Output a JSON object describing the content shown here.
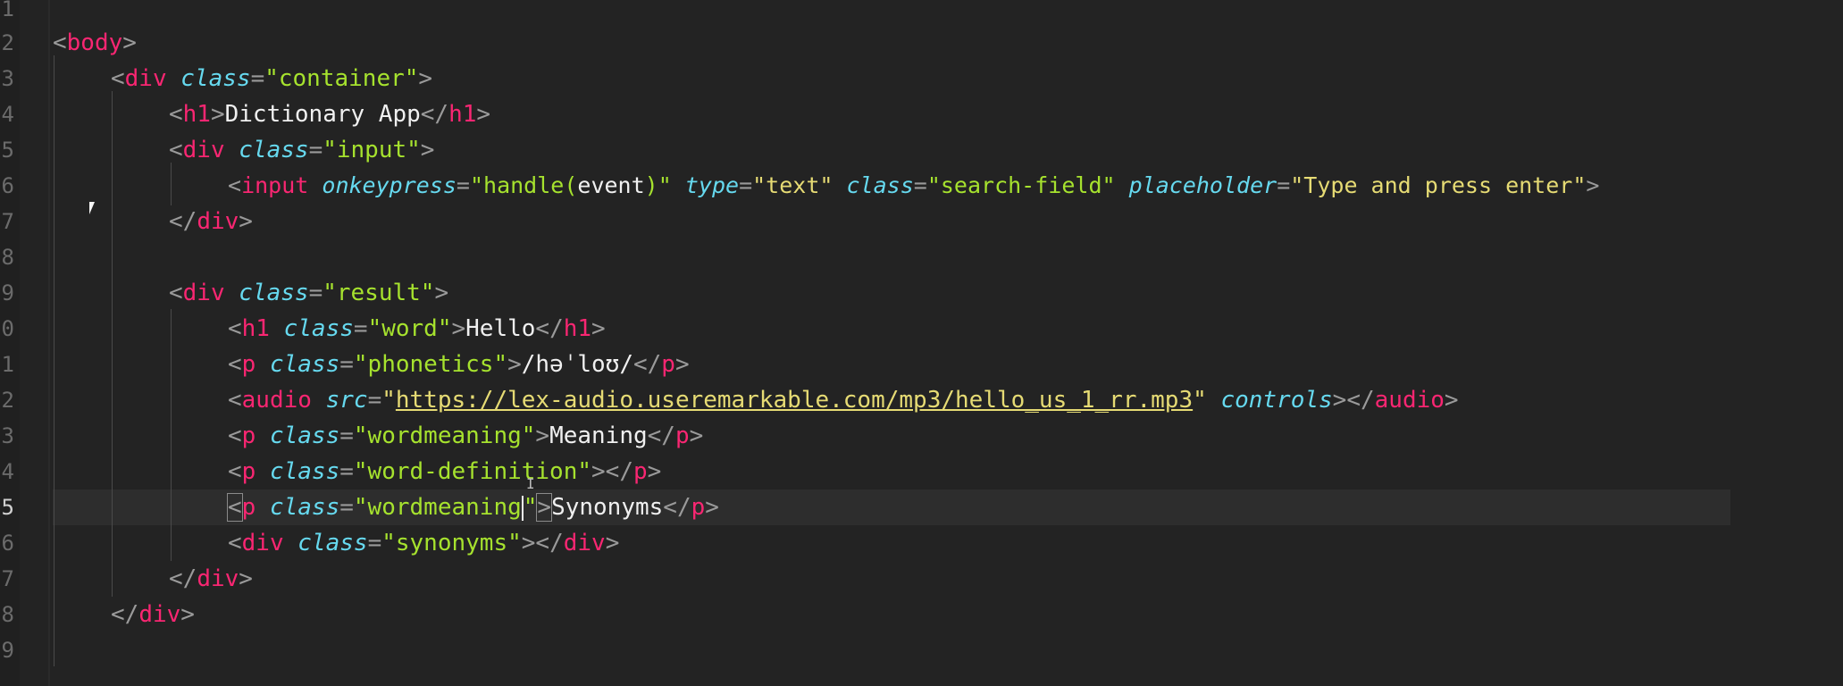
{
  "line_numbers": [
    "1",
    "2",
    "3",
    "4",
    "5",
    "6",
    "7",
    "8",
    "9",
    "0",
    "1",
    "2",
    "3",
    "4",
    "5",
    "6",
    "7",
    "8",
    "9"
  ],
  "code": {
    "l2": {
      "open": "<",
      "tag": "body",
      "close": ">"
    },
    "l3": {
      "open": "<",
      "tag": "div",
      "attr": "class",
      "eq": "=",
      "val": "\"container\"",
      "close": ">"
    },
    "l4": {
      "open": "<",
      "tag": "h1",
      "gt": ">",
      "text": "Dictionary App",
      "end_open": "</",
      "end_tag": "h1",
      "close": ">"
    },
    "l5": {
      "open": "<",
      "tag": "div",
      "attr": "class",
      "eq": "=",
      "val": "\"input\"",
      "close": ">"
    },
    "l6": {
      "open": "<",
      "tag": "input",
      "attr1": "onkeypress",
      "eq": "=",
      "q": "\"",
      "val1": "handle(",
      "val1b": "event",
      "val1c": ")",
      "attr2": "type",
      "val2": "\"text\"",
      "attr3": "class",
      "val3": "\"search-field\"",
      "attr4": "placeholder",
      "val4": "\"Type and press enter\"",
      "close": ">"
    },
    "l7": {
      "end_open": "</",
      "end_tag": "div",
      "close": ">"
    },
    "l9": {
      "open": "<",
      "tag": "div",
      "attr": "class",
      "eq": "=",
      "val": "\"result\"",
      "close": ">"
    },
    "l10": {
      "open": "<",
      "tag": "h1",
      "attr": "class",
      "eq": "=",
      "val": "\"word\"",
      "gt": ">",
      "text": "Hello",
      "end_open": "</",
      "end_tag": "h1",
      "close": ">"
    },
    "l11": {
      "open": "<",
      "tag": "p",
      "attr": "class",
      "eq": "=",
      "val": "\"phonetics\"",
      "gt": ">",
      "text": "/həˈloʊ/",
      "end_open": "</",
      "end_tag": "p",
      "close": ">"
    },
    "l12": {
      "open": "<",
      "tag": "audio",
      "attr": "src",
      "eq": "=",
      "q": "\"",
      "url": "https://lex-audio.useremarkable.com/mp3/hello_us_1_rr.mp3",
      "attr2": "controls",
      "gt": ">",
      "end_open": "</",
      "end_tag": "audio",
      "close": ">"
    },
    "l13": {
      "open": "<",
      "tag": "p",
      "attr": "class",
      "eq": "=",
      "val": "\"wordmeaning\"",
      "gt": ">",
      "text": "Meaning",
      "end_open": "</",
      "end_tag": "p",
      "close": ">"
    },
    "l14": {
      "open": "<",
      "tag": "p",
      "attr": "class",
      "eq": "=",
      "val": "\"word-definition\"",
      "gt": ">",
      "end_open": "</",
      "end_tag": "p",
      "close": ">"
    },
    "l15": {
      "open": "<",
      "tag": "p",
      "attr": "class",
      "eq": "=",
      "val_a": "\"wordmeaning",
      "val_b": "\"",
      "gt": ">",
      "text": "Synonyms",
      "end_open": "</",
      "end_tag": "p",
      "close": ">"
    },
    "l16": {
      "open": "<",
      "tag": "div",
      "attr": "class",
      "eq": "=",
      "val": "\"synonyms\"",
      "gt": ">",
      "end_open": "</",
      "end_tag": "div",
      "close": ">"
    },
    "l17": {
      "end_open": "</",
      "end_tag": "div",
      "close": ">"
    },
    "l18": {
      "end_open": "</",
      "end_tag": "div",
      "close": ">"
    }
  },
  "colors": {
    "background": "#232323",
    "tag": "#f92672",
    "attribute": "#66d9ef",
    "string": "#a6e22e",
    "string_alt": "#e6db74",
    "text": "#f0f0f0",
    "punctuation": "#9a9a9a",
    "line_number": "#6b6b6b"
  }
}
